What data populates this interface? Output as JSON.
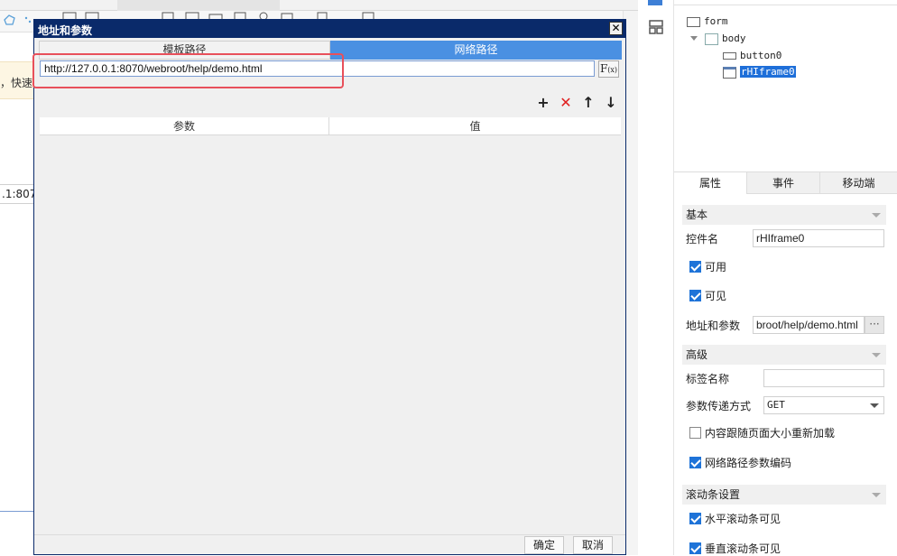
{
  "background": {
    "hint_text": "，快速",
    "url_fragment": ".1:807"
  },
  "dialog": {
    "title": "地址和参数",
    "close_label": "✕",
    "tabs": [
      {
        "label": "模板路径",
        "active": false
      },
      {
        "label": "网络路径",
        "active": true
      }
    ],
    "url_value": "http://127.0.0.1:8070/webroot/help/demo.html",
    "fx_label": "F",
    "fx_sub": "(x)",
    "toolbar": {
      "add": "+",
      "delete": "✕",
      "up": "↑",
      "down": "↓"
    },
    "table": {
      "columns": [
        "参数",
        "值"
      ],
      "rows": []
    },
    "ok_label": "确定",
    "cancel_label": "取消"
  },
  "tree": {
    "form": "form",
    "body": "body",
    "button0": "button0",
    "rhiframe0": "rHIframe0"
  },
  "panel": {
    "tabs": [
      "属性",
      "事件",
      "移动端"
    ],
    "sections": {
      "basic": "基本",
      "advanced": "高级",
      "scroll": "滚动条设置"
    },
    "props": {
      "name_label": "控件名",
      "name_value": "rHIframe0",
      "enabled_label": "可用",
      "enabled": true,
      "visible_label": "可见",
      "visible": true,
      "url_label": "地址和参数",
      "url_value": "broot/help/demo.html",
      "url_more": "···",
      "tag_label": "标签名称",
      "tag_value": "",
      "method_label": "参数传递方式",
      "method_value": "GET",
      "reload_label": "内容跟随页面大小重新加载",
      "reload": false,
      "encode_label": "网络路径参数编码",
      "encode": true,
      "hscroll_label": "水平滚动条可见",
      "hscroll": true,
      "vscroll_label": "垂直滚动条可见",
      "vscroll": true
    }
  },
  "colors": {
    "title_bar": "#0a2a6a",
    "active_tab": "#4a90e2",
    "highlight": "#e8505b",
    "checkbox": "#1e73d8",
    "delete": "#e02020"
  }
}
